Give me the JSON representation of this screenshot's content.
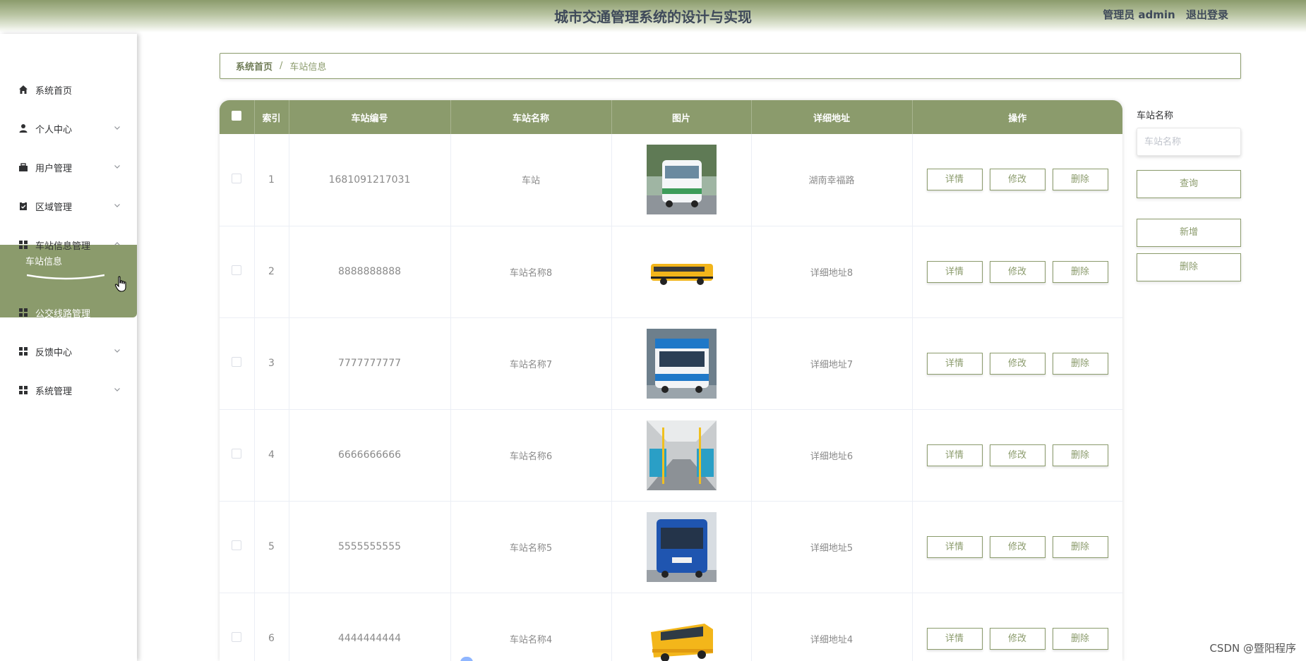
{
  "header": {
    "title": "城市交通管理系统的设计与实现",
    "user_label": "管理员 admin",
    "logout_label": "退出登录"
  },
  "sidebar": {
    "items": [
      {
        "label": "系统首页",
        "icon": "home-icon"
      },
      {
        "label": "个人中心",
        "icon": "user-icon"
      },
      {
        "label": "用户管理",
        "icon": "briefcase-icon"
      },
      {
        "label": "区域管理",
        "icon": "clipboard-icon"
      },
      {
        "label": "车站信息管理",
        "icon": "grid-icon"
      },
      {
        "label": "公交线路管理",
        "icon": "grid-icon"
      },
      {
        "label": "反馈中心",
        "icon": "grid-icon"
      },
      {
        "label": "系统管理",
        "icon": "grid-icon"
      }
    ],
    "sub_item": "车站信息"
  },
  "breadcrumb": {
    "home": "系统首页",
    "separator": "/",
    "current": "车站信息"
  },
  "table": {
    "headers": [
      "索引",
      "车站编号",
      "车站名称",
      "图片",
      "详细地址",
      "操作"
    ],
    "actions": [
      "详情",
      "修改",
      "删除"
    ],
    "rows": [
      {
        "index": "1",
        "code": "1681091217031",
        "name": "车站",
        "image": "white-green-bus-photo",
        "address": "湖南幸福路"
      },
      {
        "index": "2",
        "code": "8888888888",
        "name": "车站名称8",
        "image": "yellow-school-bus-photo",
        "address": "详细地址8"
      },
      {
        "index": "3",
        "code": "7777777777",
        "name": "车站名称7",
        "image": "blue-white-bus-photo",
        "address": "详细地址7"
      },
      {
        "index": "4",
        "code": "6666666666",
        "name": "车站名称6",
        "image": "bus-interior-photo",
        "address": "详细地址6"
      },
      {
        "index": "5",
        "code": "5555555555",
        "name": "车站名称5",
        "image": "blue-city-bus-photo",
        "address": "详细地址5"
      },
      {
        "index": "6",
        "code": "4444444444",
        "name": "车站名称4",
        "image": "yellow-bus-model-photo",
        "address": "详细地址4"
      }
    ]
  },
  "search": {
    "label": "车站名称",
    "placeholder": "车站名称",
    "query_label": "查询",
    "add_label": "新增",
    "delete_label": "删除"
  },
  "watermark": "CSDN @暨阳程序",
  "colors": {
    "accent": "#8b9b6c",
    "header_text": "#3f4a5a"
  }
}
